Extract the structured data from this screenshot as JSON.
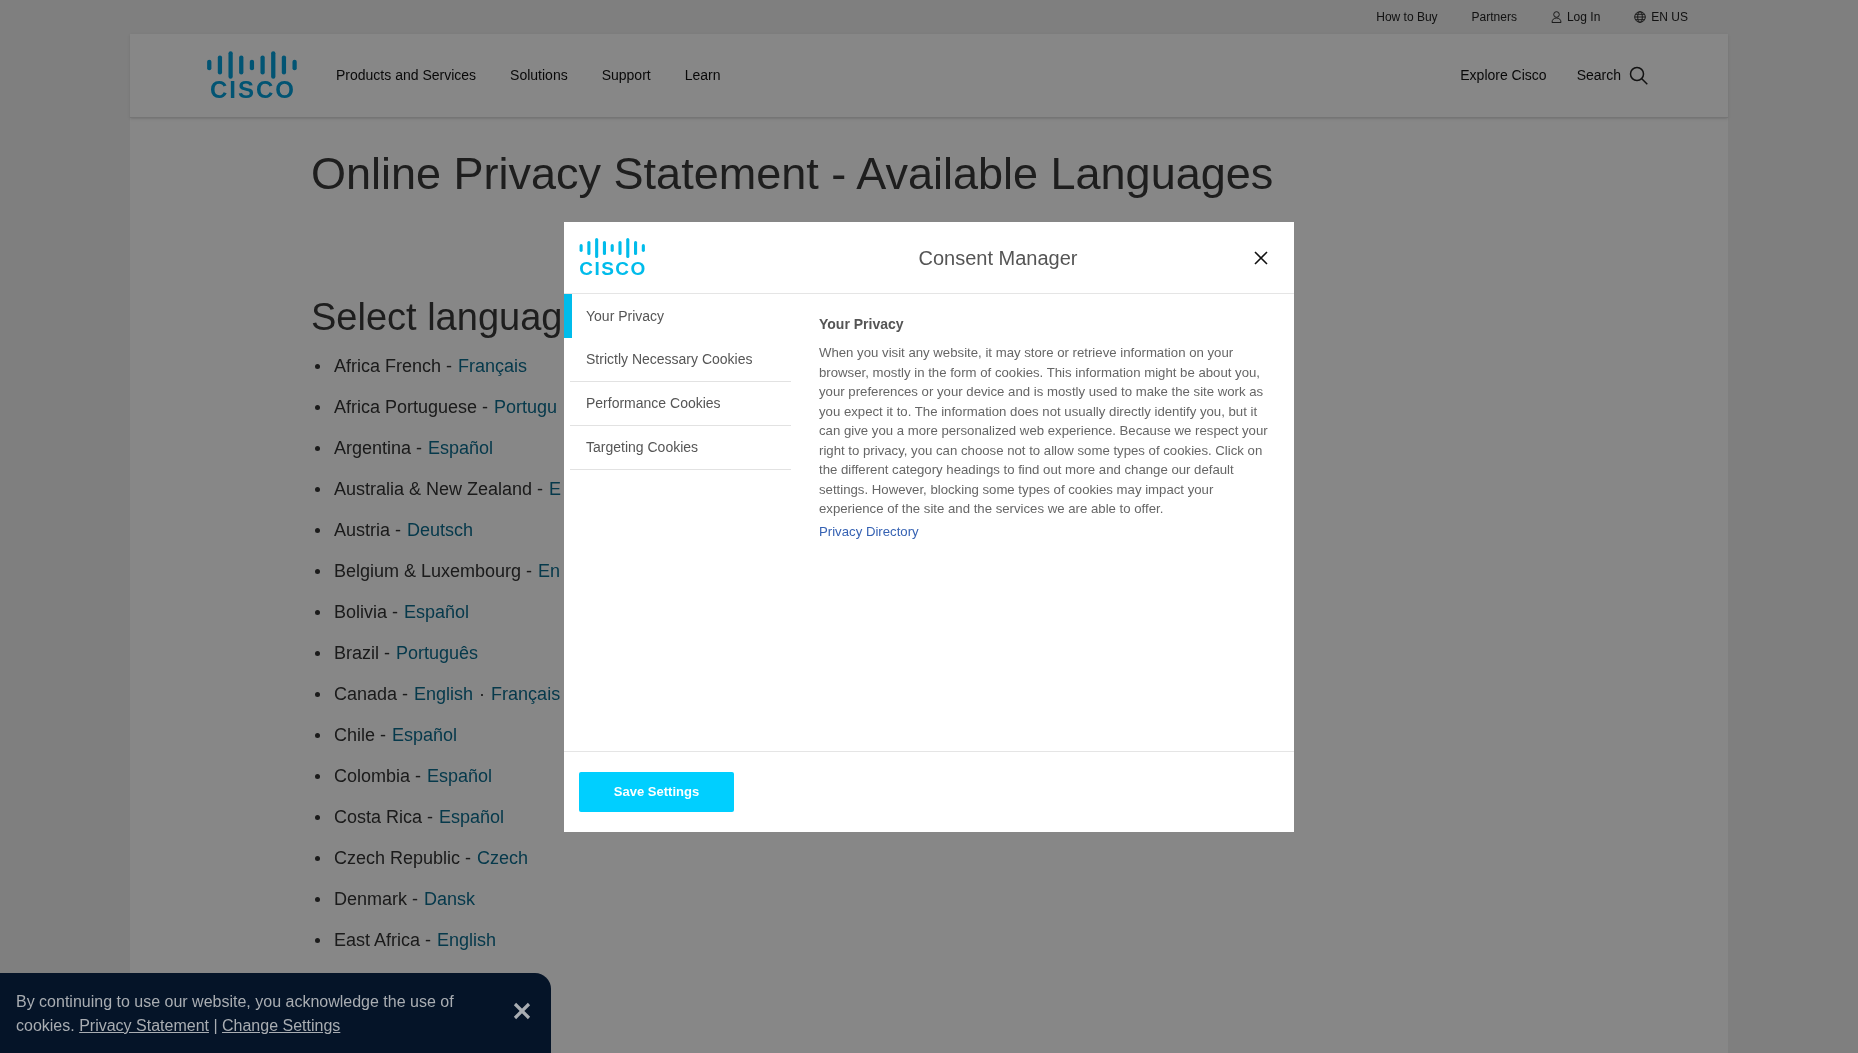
{
  "top_bar": {
    "links": [
      {
        "label": "How to Buy",
        "kind": "text"
      },
      {
        "label": "Partners",
        "kind": "text"
      },
      {
        "label": "Log In",
        "kind": "account"
      },
      {
        "label": "EN US",
        "kind": "language"
      }
    ]
  },
  "header": {
    "logo": {
      "text": "CISCO"
    },
    "nav": [
      {
        "label": "Products and Services"
      },
      {
        "label": "Solutions"
      },
      {
        "label": "Support"
      },
      {
        "label": "Learn"
      }
    ],
    "explore": "Explore Cisco",
    "search": "Search"
  },
  "page": {
    "title": "Online Privacy Statement - Available Languages",
    "subtitle": "Select languag",
    "dash": "-",
    "link_separator": "·",
    "languages": [
      {
        "region": "Africa French",
        "links": [
          "Français"
        ]
      },
      {
        "region": "Africa Portuguese",
        "links": [
          "Portugu"
        ]
      },
      {
        "region": "Argentina",
        "links": [
          "Español"
        ]
      },
      {
        "region": "Australia & New Zealand",
        "links": [
          "E"
        ]
      },
      {
        "region": "Austria",
        "links": [
          "Deutsch"
        ]
      },
      {
        "region": "Belgium & Luxembourg",
        "links": [
          "En"
        ]
      },
      {
        "region": "Bolivia",
        "links": [
          "Español"
        ]
      },
      {
        "region": "Brazil",
        "links": [
          "Português"
        ]
      },
      {
        "region": "Canada",
        "links": [
          "English",
          "Français"
        ]
      },
      {
        "region": "Chile",
        "links": [
          "Español"
        ]
      },
      {
        "region": "Colombia",
        "links": [
          "Español"
        ]
      },
      {
        "region": "Costa Rica",
        "links": [
          "Español"
        ]
      },
      {
        "region": "Czech Republic",
        "links": [
          "Czech"
        ]
      },
      {
        "region": "Denmark",
        "links": [
          "Dansk"
        ]
      },
      {
        "region": "East Africa",
        "links": [
          "English"
        ]
      }
    ]
  },
  "modal": {
    "logo": {
      "text": "CISCO"
    },
    "title": "Consent Manager",
    "tabs": [
      {
        "label": "Your Privacy",
        "selected": true
      },
      {
        "label": "Strictly Necessary Cookies",
        "selected": false
      },
      {
        "label": "Performance Cookies",
        "selected": false
      },
      {
        "label": "Targeting Cookies",
        "selected": false
      }
    ],
    "heading": "Your Privacy",
    "body": "When you visit any website, it may store or retrieve information on your browser, mostly in the form of cookies. This information might be about you, your preferences or your device and is mostly used to make the site work as you expect it to. The information does not usually directly identify you, but it can give you a more personalized web experience. Because we respect your right to privacy, you can choose not to allow some types of cookies. Click on the different category headings to find out more and change our default settings. However, blocking some types of cookies may impact your experience of the site and the services we are able to offer.",
    "link": "Privacy Directory",
    "button": "Save Settings"
  },
  "cookie_banner": {
    "text": "By continuing to use our website, you acknowledge the use of cookies.",
    "links": [
      "Privacy Statement",
      "Change Settings"
    ],
    "separator": "|"
  }
}
